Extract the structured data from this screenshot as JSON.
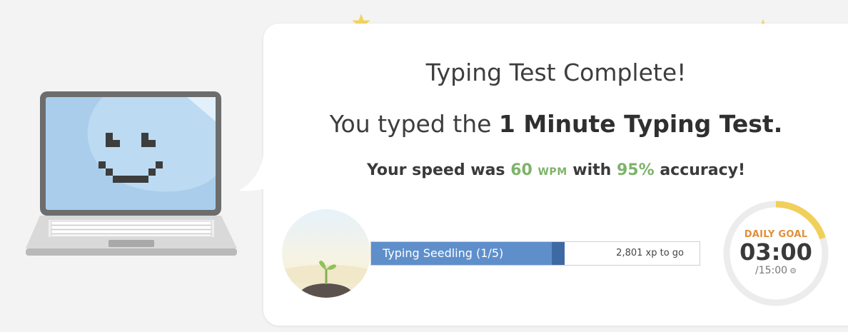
{
  "result": {
    "title": "Typing Test Complete!",
    "subtitle_prefix": "You typed the ",
    "test_name": "1 Minute Typing Test.",
    "speed_prefix": "Your speed was ",
    "wpm": "60",
    "wpm_unit": "WPM",
    "speed_mid": " with ",
    "accuracy": "95%",
    "speed_suffix": " accuracy!"
  },
  "level": {
    "label": "Typing Seedling (1/5)",
    "xp_to_go": "2,801 xp to go",
    "progress_fraction": 0.59,
    "fill_color": "#5f8fcb"
  },
  "daily_goal": {
    "label": "DAILY GOAL",
    "time": "03:00",
    "total": "/15:00",
    "progress_fraction": 0.2,
    "settings_icon": "gear-icon",
    "ring_color": "#f0cf5b"
  },
  "colors": {
    "accent_green": "#7eb36a",
    "goal_label": "#e08f3a",
    "star": "#f3d35e"
  },
  "mascot": "smiling-laptop-illustration"
}
